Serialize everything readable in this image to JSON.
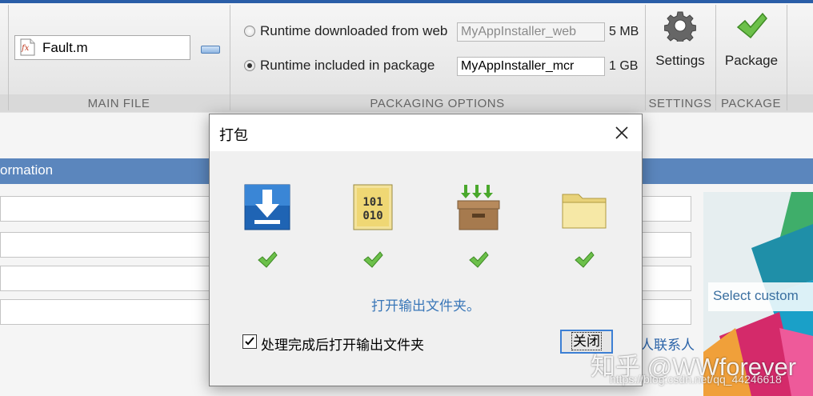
{
  "ribbon": {
    "main_file": {
      "file_name": "Fault.m",
      "group_label": "MAIN FILE"
    },
    "packaging_options": {
      "option_web": "Runtime downloaded from web",
      "option_web_field": "MyAppInstaller_web",
      "option_web_size": "5 MB",
      "option_package": "Runtime included in package",
      "option_package_field": "MyAppInstaller_mcr",
      "option_package_size": "1 GB",
      "selected": "Runtime included in package",
      "group_label": "PACKAGING OPTIONS"
    },
    "settings": {
      "label": "Settings",
      "group_label": "SETTINGS"
    },
    "package": {
      "label": "Package",
      "group_label": "PACKAGE"
    }
  },
  "background": {
    "section_header": "ormation",
    "splash_select": "Select custom",
    "contact_text": "人联系人"
  },
  "dialog": {
    "title": "打包",
    "steps": [
      {
        "icon": "download-icon",
        "done": true
      },
      {
        "icon": "binary-file-icon",
        "done": true
      },
      {
        "icon": "package-box-icon",
        "done": true
      },
      {
        "icon": "folder-icon",
        "done": true
      }
    ],
    "open_folder_link": "打开输出文件夹。",
    "checkbox_label": "处理完成后打开输出文件夹",
    "checkbox_checked": true,
    "close_button": "关闭"
  },
  "watermark": {
    "main": "知乎 @WWforever",
    "url": "https://blog.csdn.net/qq_44246618"
  },
  "colors": {
    "accent_blue": "#5b86bd",
    "link_blue": "#3a77b8",
    "check_green": "#4aa02c"
  }
}
